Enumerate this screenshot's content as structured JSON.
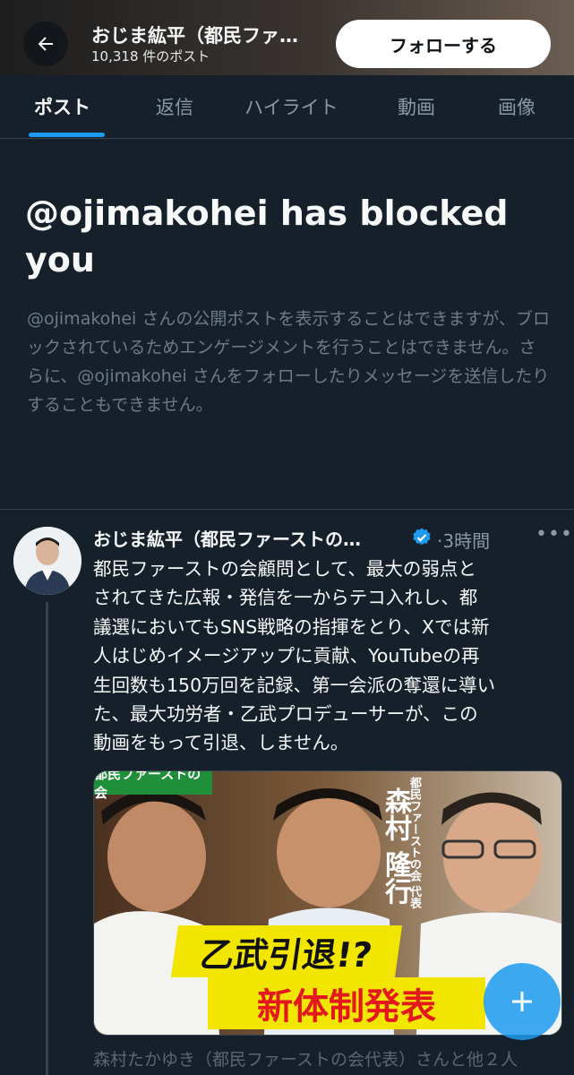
{
  "header": {
    "title": "おじま紘平（都民ファ…",
    "post_count": "10,318 件のポスト",
    "follow_label": "フォローする",
    "back_icon": "arrow-left-icon"
  },
  "tabs": [
    {
      "label": "ポスト",
      "active": true
    },
    {
      "label": "返信",
      "active": false
    },
    {
      "label": "ハイライト",
      "active": false
    },
    {
      "label": "動画",
      "active": false
    },
    {
      "label": "画像",
      "active": false
    }
  ],
  "block_notice": {
    "heading": "@ojimakohei has blocked you",
    "body": "@ojimakohei さんの公開ポストを表示することはできますが、ブロックされているためエンゲージメントを行うことはできません。さらに、@ojimakohei さんをフォローしたりメッセージを送信したりすることもできません。"
  },
  "post": {
    "author": "おじま紘平（都民ファーストの…",
    "time": "3時間",
    "more_icon": "more-horizontal-icon",
    "verified_icon": "verified-badge-icon",
    "text_lines": [
      "都民ファーストの会顧問として、最大の弱点と",
      "されてきた広報・発信を一からテコ入れし、都",
      "議選においてもSNS戦略の指揮をとり、Xでは新",
      "人はじめイメージアップに貢献、YouTubeの再",
      "生回数も150万回を記録、第一会派の奪還に導い",
      "た、最大功労者・乙武プロデューサーが、この",
      "動画をもって引退、しません。"
    ],
    "media": {
      "channel_tag": "都民ファーストの会",
      "role_label": "都民ファーストの会 代表",
      "name_label": "森村 隆行",
      "caption_top": "乙武引退!?",
      "caption_bottom": "新体制発表"
    },
    "retweet_line": "森村たかゆき（都民ファーストの会代表）さんと他２人"
  },
  "fab": {
    "icon": "compose-plus-icon"
  },
  "colors": {
    "background": "#15202b",
    "accent": "#1d9bf0",
    "muted_text": "#6e7b87",
    "caption_yellow": "#f2e600",
    "caption_red": "#e3181c"
  }
}
